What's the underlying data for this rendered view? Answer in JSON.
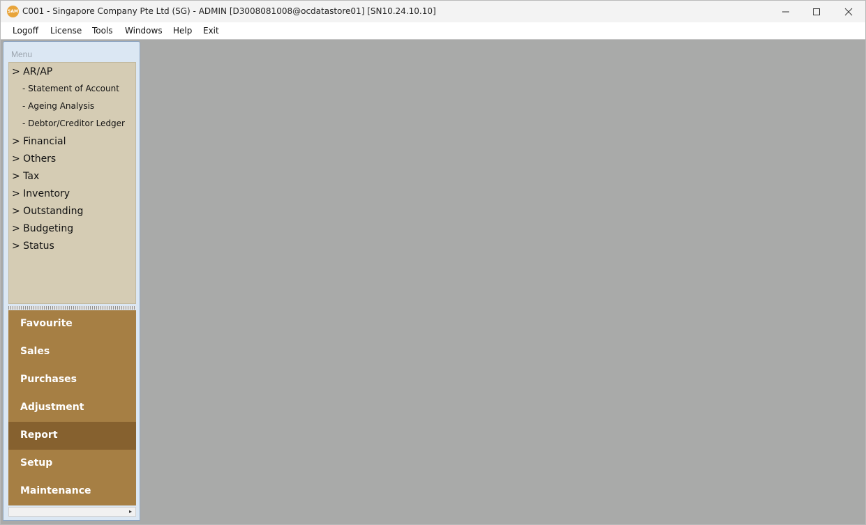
{
  "window": {
    "title": "C001 - Singapore Company Pte Ltd (SG) - ADMIN [D3008081008@ocdatastore01] [SN10.24.10.10]",
    "app_icon_text": "SAM"
  },
  "menubar": [
    {
      "label": "Logoff"
    },
    {
      "label": "License"
    },
    {
      "label": "Tools"
    },
    {
      "label": "Windows"
    },
    {
      "label": "Help"
    },
    {
      "label": "Exit"
    }
  ],
  "sidebar": {
    "caption": "Menu",
    "tree": [
      {
        "label": "> AR/AP",
        "kind": "group"
      },
      {
        "label": "- Statement of Account",
        "kind": "leaf"
      },
      {
        "label": "- Ageing Analysis",
        "kind": "leaf"
      },
      {
        "label": "- Debtor/Creditor Ledger",
        "kind": "leaf"
      },
      {
        "label": "> Financial",
        "kind": "group"
      },
      {
        "label": "> Others",
        "kind": "group"
      },
      {
        "label": "> Tax",
        "kind": "group"
      },
      {
        "label": "> Inventory",
        "kind": "group"
      },
      {
        "label": "> Outstanding",
        "kind": "group"
      },
      {
        "label": "> Budgeting",
        "kind": "group"
      },
      {
        "label": "> Status",
        "kind": "group"
      }
    ],
    "nav_buttons": [
      {
        "label": "Favourite",
        "active": false
      },
      {
        "label": "Sales",
        "active": false
      },
      {
        "label": "Purchases",
        "active": false
      },
      {
        "label": "Adjustment",
        "active": false
      },
      {
        "label": "Report",
        "active": true
      },
      {
        "label": "Setup",
        "active": false
      },
      {
        "label": "Maintenance",
        "active": false
      }
    ]
  },
  "colors": {
    "workspace": "#a9aaa9",
    "tree_background": "#d5ccb4",
    "nav_button": "#a67f44",
    "nav_button_active": "#86612f",
    "sidebar_frame": "#dbe7f3"
  }
}
